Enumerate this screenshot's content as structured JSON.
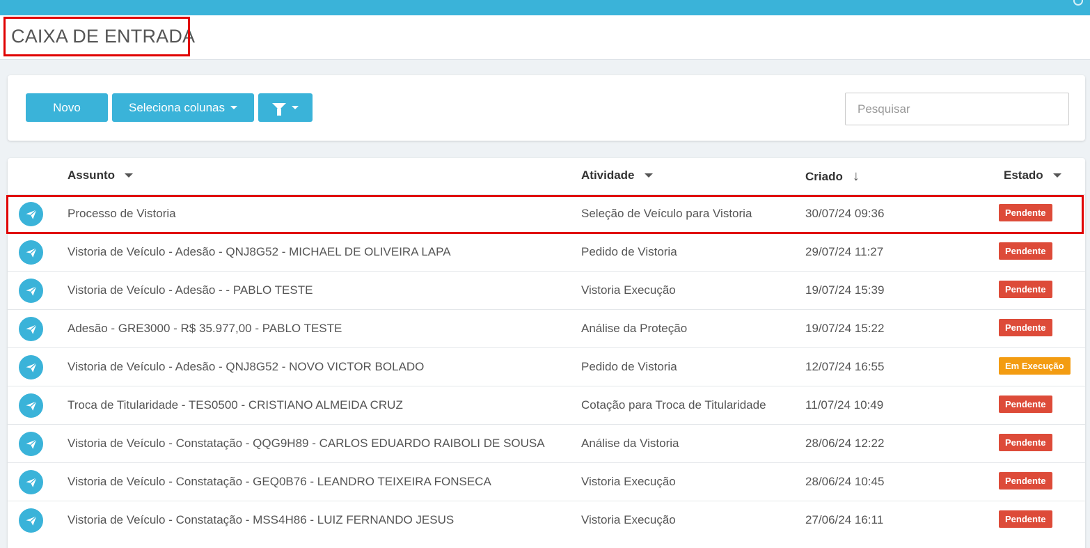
{
  "header": {
    "title": "CAIXA DE ENTRADA"
  },
  "toolbar": {
    "novo_label": "Novo",
    "columns_label": "Seleciona colunas",
    "filter_icon": "filter-icon",
    "search_placeholder": "Pesquisar"
  },
  "table": {
    "headers": {
      "assunto": "Assunto",
      "atividade": "Atividade",
      "criado": "Criado",
      "estado": "Estado"
    },
    "rows": [
      {
        "assunto": "Processo de Vistoria",
        "atividade": "Seleção de Veículo para Vistoria",
        "criado": "30/07/24 09:36",
        "estado": "Pendente"
      },
      {
        "assunto": "Vistoria de Veículo - Adesão - QNJ8G52 - MICHAEL DE OLIVEIRA LAPA",
        "atividade": "Pedido de Vistoria",
        "criado": "29/07/24 11:27",
        "estado": "Pendente"
      },
      {
        "assunto": "Vistoria de Veículo - Adesão -  - PABLO TESTE",
        "atividade": "Vistoria Execução",
        "criado": "19/07/24 15:39",
        "estado": "Pendente"
      },
      {
        "assunto": "Adesão - GRE3000 - R$ 35.977,00 - PABLO TESTE",
        "atividade": "Análise da Proteção",
        "criado": "19/07/24 15:22",
        "estado": "Pendente"
      },
      {
        "assunto": "Vistoria de Veículo - Adesão - QNJ8G52 - NOVO VICTOR BOLADO",
        "atividade": "Pedido de Vistoria",
        "criado": "12/07/24 16:55",
        "estado": "Em Execução"
      },
      {
        "assunto": "Troca de Titularidade - TES0500 - CRISTIANO ALMEIDA CRUZ",
        "atividade": "Cotação para Troca de Titularidade",
        "criado": "11/07/24 10:49",
        "estado": "Pendente"
      },
      {
        "assunto": "Vistoria de Veículo - Constatação - QQG9H89 - CARLOS EDUARDO RAIBOLI DE SOUSA",
        "atividade": "Análise da Vistoria",
        "criado": "28/06/24 12:22",
        "estado": "Pendente"
      },
      {
        "assunto": "Vistoria de Veículo - Constatação - GEQ0B76 - LEANDRO TEIXEIRA FONSECA",
        "atividade": "Vistoria Execução",
        "criado": "28/06/24 10:45",
        "estado": "Pendente"
      },
      {
        "assunto": "Vistoria de Veículo - Constatação - MSS4H86 - LUIZ FERNANDO JESUS",
        "atividade": "Vistoria Execução",
        "criado": "27/06/24 16:11",
        "estado": "Pendente"
      }
    ]
  },
  "colors": {
    "accent": "#3ab3d9",
    "pendente": "#dd4b39",
    "em_execucao": "#f39c12",
    "highlight": "#e00000"
  }
}
